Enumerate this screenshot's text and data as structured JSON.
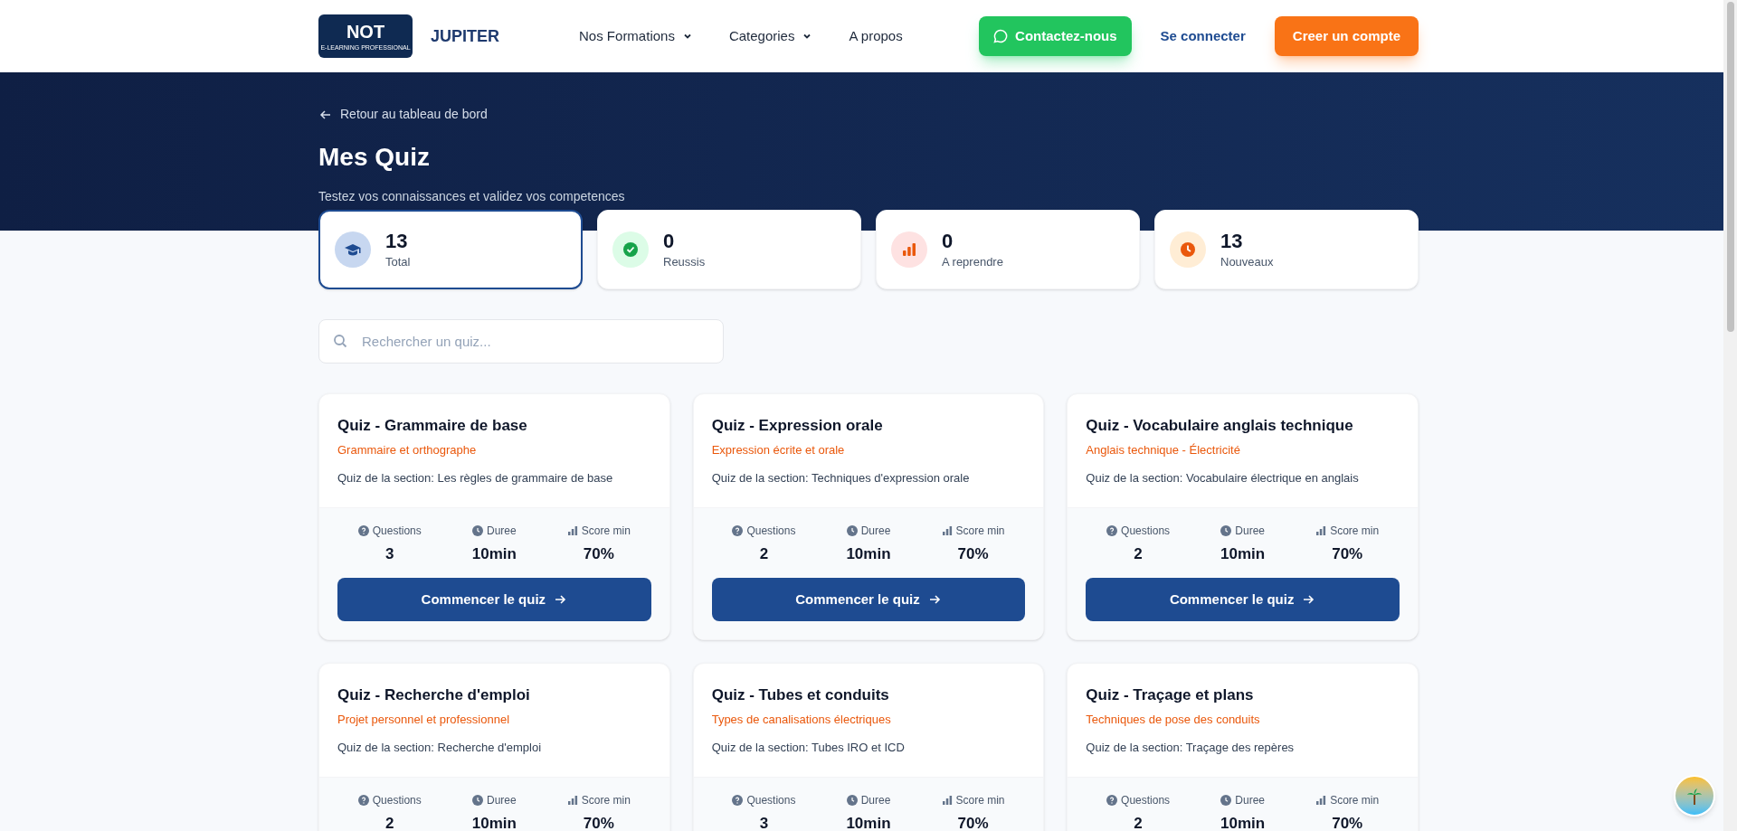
{
  "header": {
    "logo_text": "NOT",
    "logo_subtext": "E-LEARNING PROFESSIONAL",
    "brand": "JUPITER",
    "nav": [
      {
        "label": "Nos Formations",
        "dropdown": true
      },
      {
        "label": "Categories",
        "dropdown": true
      },
      {
        "label": "A propos",
        "dropdown": false
      }
    ],
    "contact_button": "Contactez-nous",
    "login_link": "Se connecter",
    "signup_button": "Creer un compte"
  },
  "hero": {
    "back_link": "Retour au tableau de bord",
    "title": "Mes Quiz",
    "subtitle": "Testez vos connaissances et validez vos competences"
  },
  "stats": [
    {
      "kind": "total",
      "value": "13",
      "label": "Total",
      "selected": true
    },
    {
      "kind": "passed",
      "value": "0",
      "label": "Reussis",
      "selected": false
    },
    {
      "kind": "retry",
      "value": "0",
      "label": "A reprendre",
      "selected": false
    },
    {
      "kind": "new",
      "value": "13",
      "label": "Nouveaux",
      "selected": false
    }
  ],
  "search": {
    "placeholder": "Rechercher un quiz..."
  },
  "quizzes": [
    {
      "title": "Quiz - Grammaire de base",
      "category": "Grammaire et orthographe",
      "description": "Quiz de la section: Les règles de grammaire de base",
      "metrics": [
        {
          "kind": "questions",
          "label": "Questions",
          "value": "3"
        },
        {
          "kind": "duration",
          "label": "Duree",
          "value": "10min"
        },
        {
          "kind": "score",
          "label": "Score min",
          "value": "70%"
        }
      ],
      "button": "Commencer le quiz"
    },
    {
      "title": "Quiz - Expression orale",
      "category": "Expression écrite et orale",
      "description": "Quiz de la section: Techniques d'expression orale",
      "metrics": [
        {
          "kind": "questions",
          "label": "Questions",
          "value": "2"
        },
        {
          "kind": "duration",
          "label": "Duree",
          "value": "10min"
        },
        {
          "kind": "score",
          "label": "Score min",
          "value": "70%"
        }
      ],
      "button": "Commencer le quiz"
    },
    {
      "title": "Quiz - Vocabulaire anglais technique",
      "category": "Anglais technique - Électricité",
      "description": "Quiz de la section: Vocabulaire électrique en anglais",
      "metrics": [
        {
          "kind": "questions",
          "label": "Questions",
          "value": "2"
        },
        {
          "kind": "duration",
          "label": "Duree",
          "value": "10min"
        },
        {
          "kind": "score",
          "label": "Score min",
          "value": "70%"
        }
      ],
      "button": "Commencer le quiz"
    },
    {
      "title": "Quiz - Recherche d'emploi",
      "category": "Projet personnel et professionnel",
      "description": "Quiz de la section: Recherche d'emploi",
      "metrics": [
        {
          "kind": "questions",
          "label": "Questions",
          "value": "2"
        },
        {
          "kind": "duration",
          "label": "Duree",
          "value": "10min"
        },
        {
          "kind": "score",
          "label": "Score min",
          "value": "70%"
        }
      ]
    },
    {
      "title": "Quiz - Tubes et conduits",
      "category": "Types de canalisations électriques",
      "description": "Quiz de la section: Tubes IRO et ICD",
      "metrics": [
        {
          "kind": "questions",
          "label": "Questions",
          "value": "3"
        },
        {
          "kind": "duration",
          "label": "Duree",
          "value": "10min"
        },
        {
          "kind": "score",
          "label": "Score min",
          "value": "70%"
        }
      ]
    },
    {
      "title": "Quiz - Traçage et plans",
      "category": "Techniques de pose des conduits",
      "description": "Quiz de la section: Traçage des repères",
      "metrics": [
        {
          "kind": "questions",
          "label": "Questions",
          "value": "2"
        },
        {
          "kind": "duration",
          "label": "Duree",
          "value": "10min"
        },
        {
          "kind": "score",
          "label": "Score min",
          "value": "70%"
        }
      ]
    }
  ]
}
